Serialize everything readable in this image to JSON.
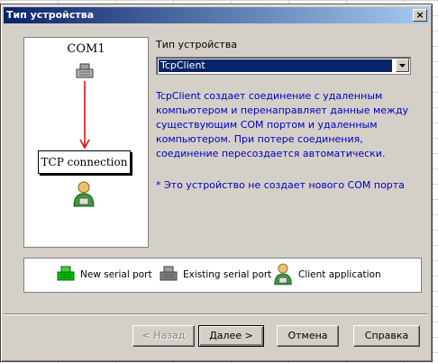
{
  "window": {
    "title": "Тип устройства",
    "close_label": "×"
  },
  "diagram": {
    "com_label": "COM1",
    "tcp_label": "TCP connection",
    "arrow_color": "#e00000"
  },
  "device_type": {
    "label": "Тип устройства",
    "selected": "TcpClient"
  },
  "description": "TcpClient создает соединение с удаленным компьютером и перенаправляет данные между существующим COM портом и удаленным компьютером. При потере соединения, соединение пересоздается автоматически.",
  "note": "* Это устройство не создает нового COM порта",
  "legend": {
    "items": [
      {
        "label": "New serial port",
        "icon": "new-serial-port-icon",
        "color": "#00c000"
      },
      {
        "label": "Existing serial port",
        "icon": "existing-serial-port-icon",
        "color": "#808080"
      },
      {
        "label": "Client application",
        "icon": "client-application-icon",
        "color": "#e0a000"
      }
    ]
  },
  "buttons": {
    "back": "< Назад",
    "next": "Далее >",
    "cancel": "Отмена",
    "help": "Справка"
  },
  "colors": {
    "accent": "#0a246a",
    "description_text": "#0000c0"
  }
}
